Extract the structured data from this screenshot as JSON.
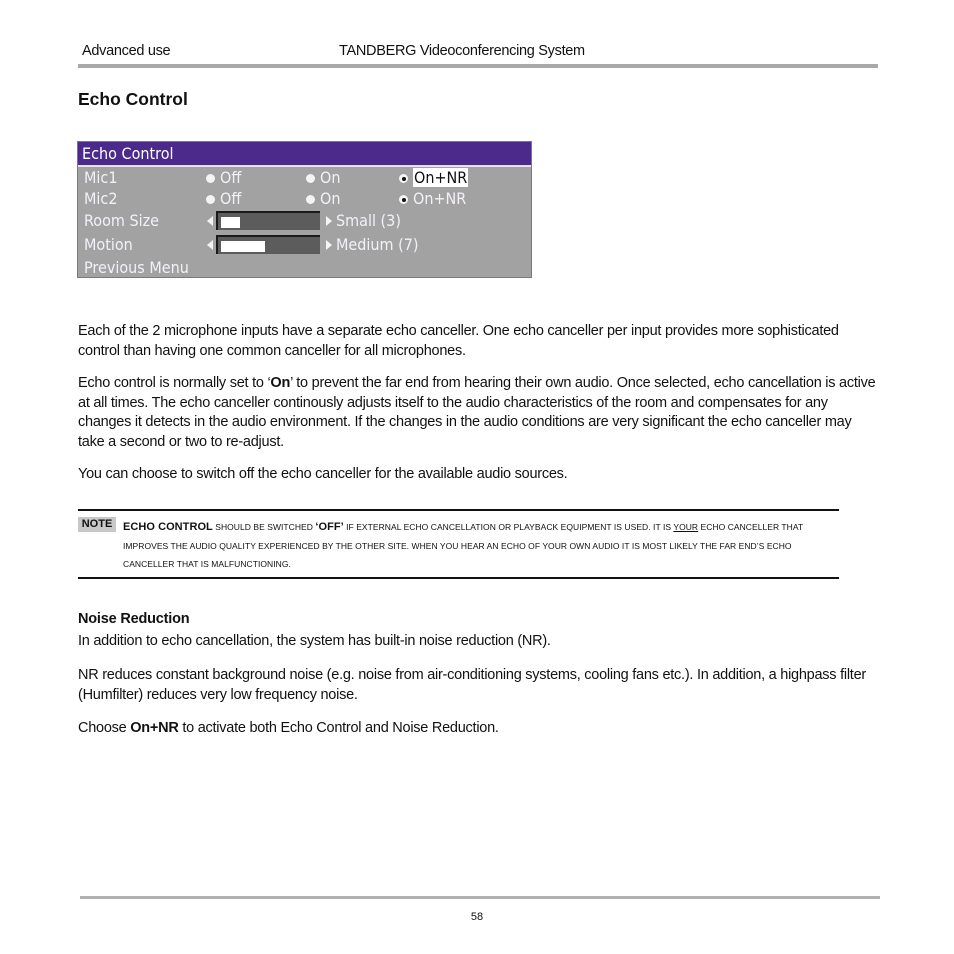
{
  "header": {
    "section": "Advanced use",
    "product": "TANDBERG Videoconferencing System"
  },
  "title": "Echo Control",
  "osd_menu": {
    "title": "Echo Control",
    "title_color": "#4b2a8c",
    "rows": [
      {
        "label": "Mic1",
        "options": [
          "Off",
          "On",
          "On+NR"
        ],
        "selected": "On+NR",
        "highlighted": true
      },
      {
        "label": "Mic2",
        "options": [
          "Off",
          "On",
          "On+NR"
        ],
        "selected": "On+NR",
        "highlighted": false
      }
    ],
    "sliders": [
      {
        "label": "Room Size",
        "value_text": "Small (3)",
        "value": 3,
        "fill_fraction": 0.2
      },
      {
        "label": "Motion",
        "value_text": "Medium (7)",
        "value": 7,
        "fill_fraction": 0.45
      }
    ],
    "previous_menu": "Previous Menu"
  },
  "paragraphs": {
    "p1": "Each of the 2 microphone inputs have a separate echo canceller. One echo canceller per input provides more sophisticated control than having one common canceller for all microphones.",
    "p2_pre": "Echo control is normally set to ‘",
    "p2_bold": "On",
    "p2_post": "’ to prevent the far end from hearing their own audio. Once selected, echo cancellation is active at all times. The echo canceller continously adjusts itself to the audio characteristics of the room and compensates for any changes it detects in the audio environment. If the changes in the audio conditions are very significant the echo canceller may take a second or two to re-adjust.",
    "p3": "You can choose to switch off the echo canceller for the available audio sources."
  },
  "note": {
    "badge": "NOTE",
    "lead": "Echo Control",
    "t1": " should be switched ",
    "off": "‘Off’",
    "t2": " if external echo cancellation or playback equipment is used. It is ",
    "your": "your",
    "t3": " echo canceller that improves the audio quality experienced by the other site. When you hear an echo of your own audio it is most likely the far end’s echo canceller that is malfunctioning."
  },
  "noise_reduction": {
    "heading": "Noise Reduction",
    "p1": "In addition to echo cancellation, the system has built-in noise reduction (NR).",
    "p2": "NR reduces constant background noise (e.g. noise from air-conditioning systems, cooling fans etc.). In addition, a highpass filter (Humfilter) reduces very low frequency noise.",
    "p3_pre": "Choose ",
    "p3_bold": "On+NR",
    "p3_post": " to activate both Echo Control and Noise Reduction."
  },
  "footer": {
    "page_number": "58"
  }
}
